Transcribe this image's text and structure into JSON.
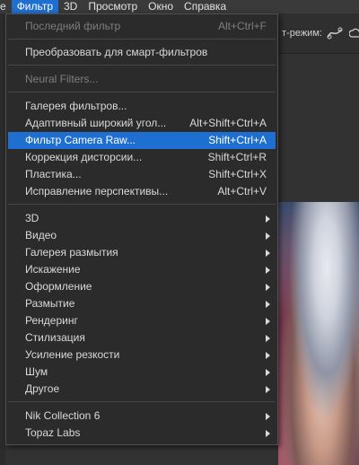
{
  "menubar": {
    "items": [
      {
        "label": "е",
        "active": false
      },
      {
        "label": "Фильтр",
        "active": true
      },
      {
        "label": "3D",
        "active": false
      },
      {
        "label": "Просмотр",
        "active": false
      },
      {
        "label": "Окно",
        "active": false
      },
      {
        "label": "Справка",
        "active": false
      }
    ]
  },
  "options_bar": {
    "partial_label": "т-режим:",
    "icons": [
      "warp-icon",
      "cloud-icon"
    ]
  },
  "filter_menu": {
    "items": [
      {
        "label": "Последний фильтр",
        "shortcut": "Alt+Ctrl+F",
        "disabled": true
      },
      {
        "label": "Преобразовать для смарт-фильтров",
        "shortcut": ""
      },
      {
        "label": "Neural Filters...",
        "shortcut": "",
        "disabled": true
      },
      {
        "label": "Галерея фильтров...",
        "shortcut": ""
      },
      {
        "label": "Адаптивный широкий угол...",
        "shortcut": "Alt+Shift+Ctrl+A"
      },
      {
        "label": "Фильтр Camera Raw...",
        "shortcut": "Shift+Ctrl+A",
        "highlighted": true
      },
      {
        "label": "Коррекция дисторсии...",
        "shortcut": "Shift+Ctrl+R"
      },
      {
        "label": "Пластика...",
        "shortcut": "Shift+Ctrl+X"
      },
      {
        "label": "Исправление перспективы...",
        "shortcut": "Alt+Ctrl+V"
      },
      {
        "label": "3D",
        "submenu": true
      },
      {
        "label": "Видео",
        "submenu": true
      },
      {
        "label": "Галерея размытия",
        "submenu": true
      },
      {
        "label": "Искажение",
        "submenu": true
      },
      {
        "label": "Оформление",
        "submenu": true
      },
      {
        "label": "Размытие",
        "submenu": true
      },
      {
        "label": "Рендеринг",
        "submenu": true
      },
      {
        "label": "Стилизация",
        "submenu": true
      },
      {
        "label": "Усиление резкости",
        "submenu": true
      },
      {
        "label": "Шум",
        "submenu": true
      },
      {
        "label": "Другое",
        "submenu": true
      },
      {
        "label": "Nik Collection 6",
        "submenu": true
      },
      {
        "label": "Topaz Labs",
        "submenu": true
      }
    ]
  },
  "colors": {
    "highlight": "#1f6fd0",
    "menu_bg": "#2b2b2b",
    "disabled_text": "#7e7e7e"
  }
}
